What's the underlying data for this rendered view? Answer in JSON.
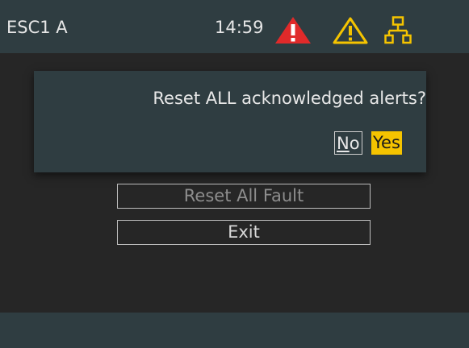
{
  "header": {
    "title": "ESC1 A",
    "time": "14:59",
    "icons": [
      "alarm-icon",
      "warning-icon",
      "network-icon"
    ],
    "colors": {
      "alarm": "#e02a2a",
      "warning": "#f5c400",
      "network": "#f5c400"
    }
  },
  "menu": {
    "items": [
      {
        "label": "Reset All Fault",
        "enabled": false
      },
      {
        "label": "Exit",
        "enabled": true
      }
    ]
  },
  "dialog": {
    "message": "Reset ALL acknowledged alerts?",
    "no_mnemonic": "N",
    "no_rest": "o",
    "yes_label": "Yes",
    "yes_color": "#f5c400"
  }
}
